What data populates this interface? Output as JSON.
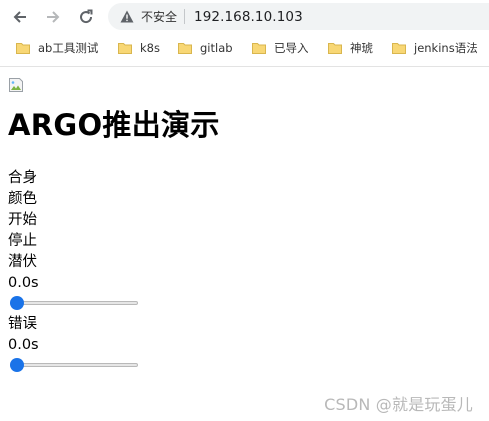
{
  "browser": {
    "security_label": "不安全",
    "url": "192.168.10.103",
    "icons": {
      "back": "back-arrow-icon",
      "forward": "forward-arrow-icon",
      "reload": "reload-icon",
      "warning": "warning-triangle-icon",
      "folder": "folder-icon"
    }
  },
  "bookmarks": [
    {
      "label": "ab工具测试"
    },
    {
      "label": "k8s"
    },
    {
      "label": "gitlab"
    },
    {
      "label": "已导入"
    },
    {
      "label": "神琥"
    },
    {
      "label": "jenkins语法"
    }
  ],
  "page": {
    "image_alt": "",
    "title": "ARGO推出演示",
    "labels": [
      "合身",
      "颜色",
      "开始",
      "停止"
    ],
    "sliders": [
      {
        "label": "潜伏",
        "value_text": "0.0s",
        "value": 0
      },
      {
        "label": "错误",
        "value_text": "0.0s",
        "value": 0
      }
    ]
  },
  "watermark": "CSDN @就是玩蛋儿",
  "colors": {
    "slider_accent": "#1a73e8",
    "folder": "#f8d775"
  }
}
